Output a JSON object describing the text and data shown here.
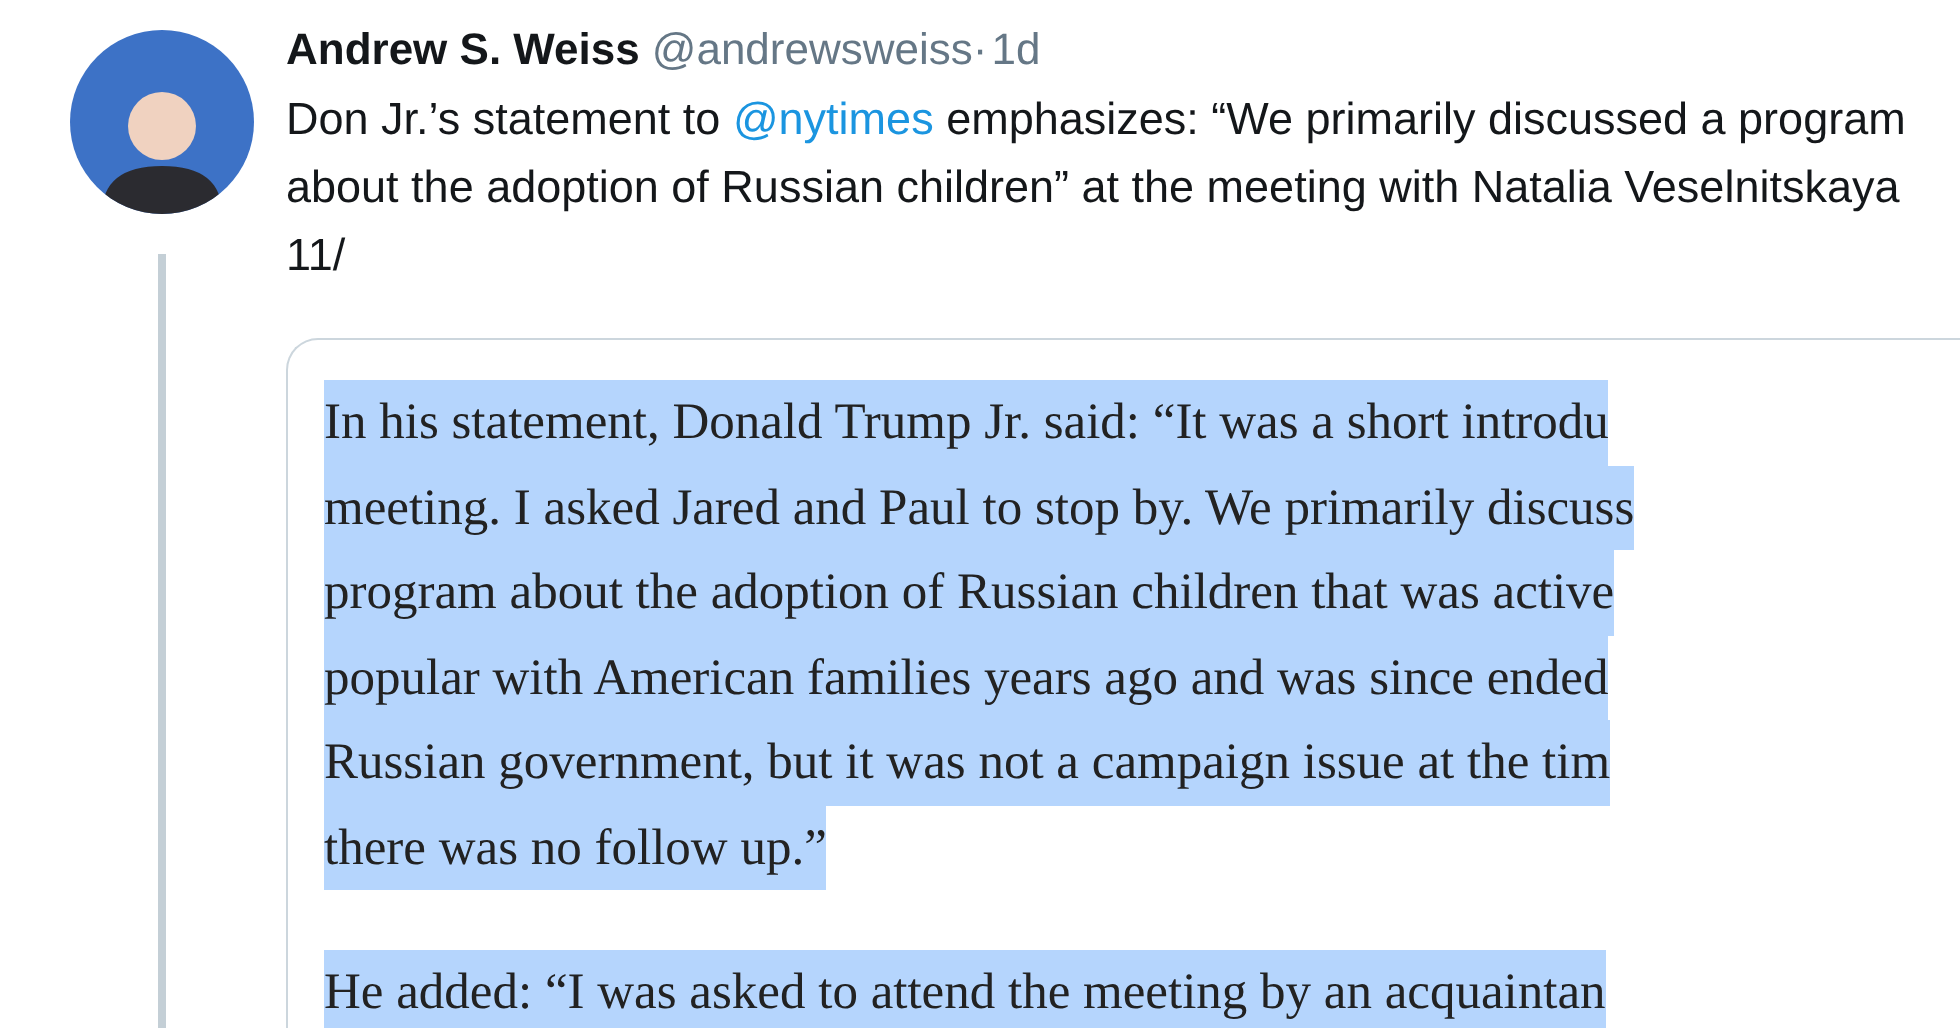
{
  "tweet": {
    "author": {
      "name": "Andrew S. Weiss",
      "handle": "@andrewsweiss",
      "separator": "·",
      "time": "1d"
    },
    "text": [
      {
        "kind": "text",
        "value": "Don Jr.’s statement to "
      },
      {
        "kind": "mention",
        "value": "@nytimes"
      },
      {
        "kind": "text",
        "value": " emphasizes: “We primarily discussed a program about the adoption of Russian children” at the meeting with Natalia Veselnitskaya 11/"
      }
    ],
    "embedded_image": {
      "paragraphs": [
        {
          "lines": [
            "In his statement, Donald Trump Jr. said: “It was a short introdu",
            "meeting. I asked Jared and Paul to stop by. We primarily discuss",
            "program about the adoption of Russian children that was active",
            "popular with American families years ago and was since ended",
            "Russian government, but it was not a campaign issue at the tim",
            "there was no follow up.”"
          ]
        },
        {
          "lines": [
            "He added: “I was asked to attend the meeting by an acquaintan"
          ]
        }
      ]
    }
  }
}
